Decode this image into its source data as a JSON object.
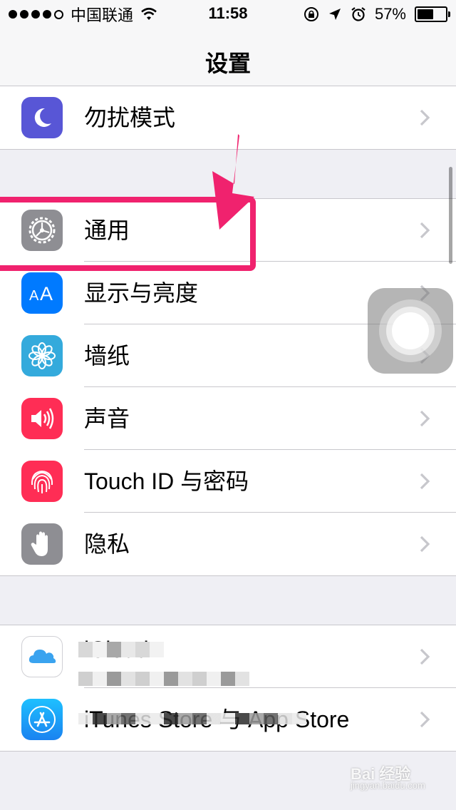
{
  "status_bar": {
    "carrier": "中国联通",
    "time": "11:58",
    "battery": "57%",
    "battery_level": 0.57,
    "signal_bars_filled": 4,
    "icons": [
      "wifi-icon",
      "rotation-lock-icon",
      "location-arrow-icon",
      "alarm-icon",
      "battery-icon"
    ]
  },
  "nav": {
    "title": "设置"
  },
  "groups": [
    {
      "items": [
        {
          "label": "勿扰模式",
          "icon": "moon-icon",
          "color": "#5856d6"
        }
      ]
    },
    {
      "items": [
        {
          "label": "通用",
          "icon": "gear-icon",
          "color": "#8e8e93"
        },
        {
          "label": "显示与亮度",
          "icon": "aa-text-icon",
          "color": "#007aff"
        },
        {
          "label": "墙纸",
          "icon": "flower-icon",
          "color": "#34aadc"
        },
        {
          "label": "声音",
          "icon": "speaker-icon",
          "color": "#ff2d55"
        },
        {
          "label": "Touch ID 与密码",
          "icon": "fingerprint-icon",
          "color": "#ff2d55"
        },
        {
          "label": "隐私",
          "icon": "hand-icon",
          "color": "#8e8e93"
        }
      ]
    },
    {
      "items": [
        {
          "label": "iCloud",
          "icon": "cloud-icon",
          "color": "#ffffff"
        },
        {
          "label": "iTunes Store 与 App Store",
          "icon": "app-store-icon",
          "color": "#1a9cf0"
        }
      ]
    }
  ],
  "annotation": {
    "highlight_color": "#f0226e"
  },
  "watermark": {
    "brand": "Bai 经验",
    "url": "jingyan.baidu.com"
  }
}
